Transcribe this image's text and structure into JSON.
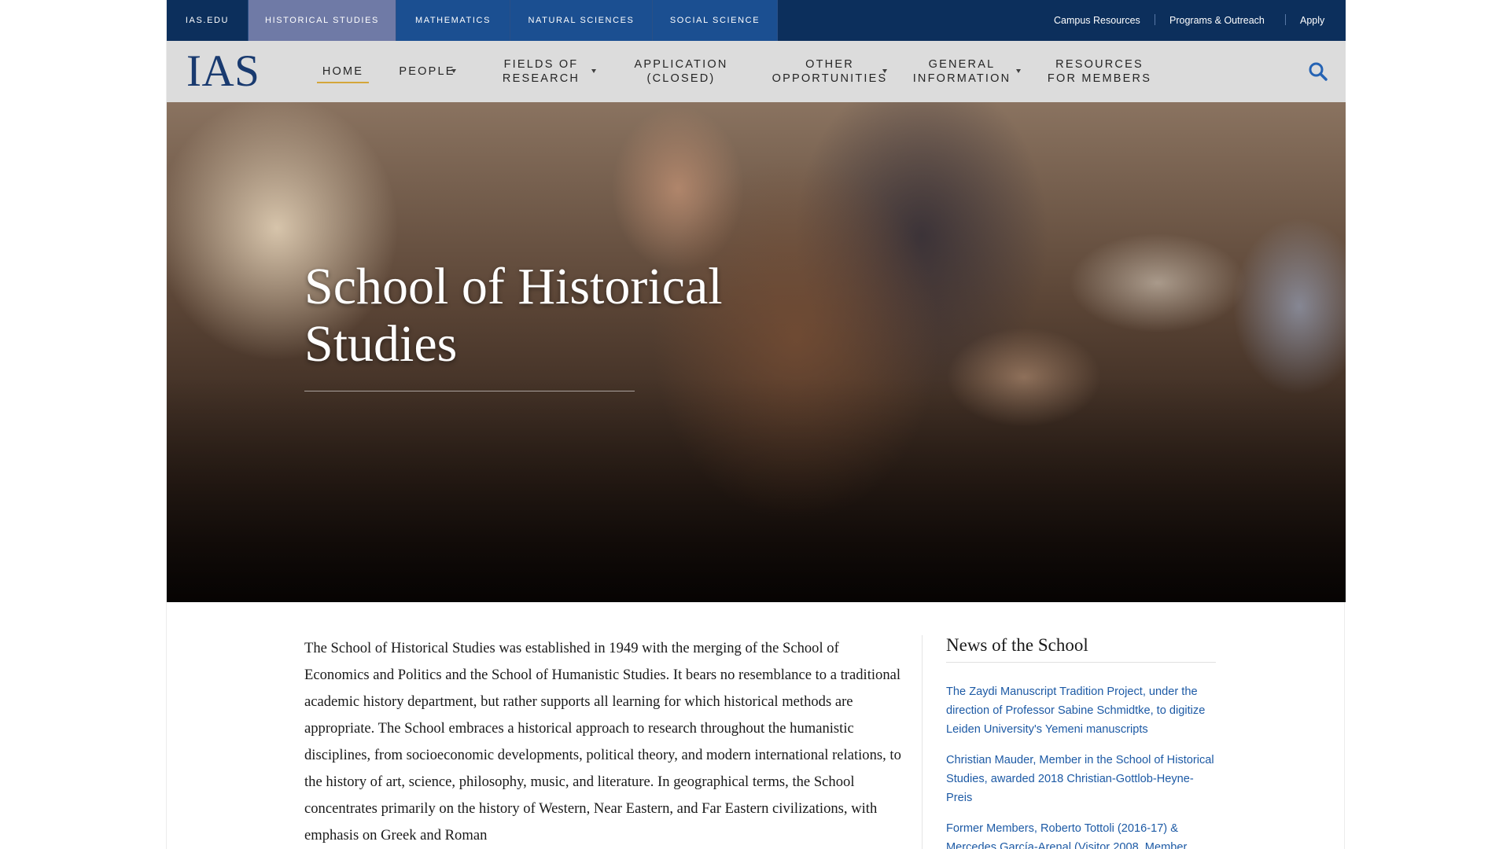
{
  "topbar": {
    "schools": [
      {
        "label": "IAS.EDU"
      },
      {
        "label": "HISTORICAL STUDIES"
      },
      {
        "label": "MATHEMATICS"
      },
      {
        "label": "NATURAL SCIENCES"
      },
      {
        "label": "SOCIAL SCIENCE"
      }
    ],
    "utility_links": [
      {
        "label": "Campus Resources"
      },
      {
        "label": "Programs & Outreach"
      },
      {
        "label": "Apply"
      }
    ]
  },
  "nav": {
    "logo": "IAS",
    "items": [
      {
        "line1": "HOME",
        "line2": ""
      },
      {
        "line1": "PEOPLE",
        "line2": ""
      },
      {
        "line1": "FIELDS OF",
        "line2": "RESEARCH"
      },
      {
        "line1": "APPLICATION",
        "line2": "(CLOSED)"
      },
      {
        "line1": "OTHER",
        "line2": "OPPORTUNITIES"
      },
      {
        "line1": "GENERAL",
        "line2": "INFORMATION"
      },
      {
        "line1": "RESOURCES",
        "line2": "FOR MEMBERS"
      }
    ],
    "search_icon": "search-icon",
    "accent_color": "#d4a63a"
  },
  "hero": {
    "title": "School of Historical Studies"
  },
  "main": {
    "intro_paragraph": "The School of Historical Studies was established in 1949 with the merging of the School of Economics and Politics and the School of Humanistic Studies.  It bears no resemblance to a traditional academic history department, but rather supports all learning for which historical methods are appropriate.  The School embraces a historical approach to research throughout the humanistic disciplines, from socioeconomic developments, political theory, and modern international relations, to the history of art, science, philosophy, music, and literature.  In geographical terms, the School concentrates primarily on the history of Western, Near Eastern, and Far Eastern civilizations, with emphasis on Greek and Roman"
  },
  "sidebar": {
    "heading": "News of the School",
    "news": [
      {
        "text": "The Zaydi Manuscript Tradition Project, under the direction of Professor Sabine Schmidtke, to digitize Leiden University's Yemeni manuscripts"
      },
      {
        "text": "Christian Mauder, Member in the School of Historical Studies, awarded 2018 Christian-Gottlob-Heyne-Preis"
      },
      {
        "text": "Former Members, Roberto Tottoli (2016-17) & Mercedes García-Arenal (Visitor 2008, Member"
      }
    ]
  },
  "colors": {
    "topbar": "#0c2f5c",
    "active_tab": "#6f7aa6",
    "nav_background": "#dcdcdc",
    "link": "#1d5aa5"
  }
}
